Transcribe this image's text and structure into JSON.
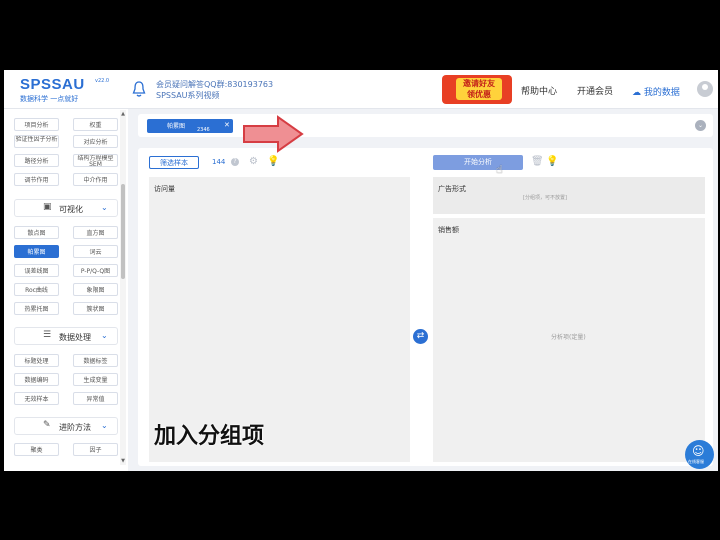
{
  "header": {
    "logo": {
      "title": "SPSSAU",
      "version": "v22.0",
      "slogan": "数据科学 一点就好"
    },
    "contact_line1": "会员疑问解答QQ群:830193763",
    "contact_line2": "SPSSAU系列视频",
    "promo": {
      "line1": "邀请好友",
      "line2": "领优惠"
    },
    "nav": [
      "帮助中心",
      "开通会员"
    ],
    "my_data": "我的数据"
  },
  "sidebar": {
    "top_buttons": [
      [
        "项目分析",
        "权重"
      ],
      [
        "验证性因子分析",
        "对应分析"
      ],
      [
        "路径分析",
        "结构方程模型SEM"
      ],
      [
        "调节作用",
        "中介作用"
      ]
    ],
    "visualization": {
      "title": "可视化",
      "buttons": [
        [
          "散点图",
          "直方图"
        ],
        [
          "帕累图",
          "词云"
        ],
        [
          "误差线图",
          "P-P/Q-Q图"
        ],
        [
          "Roc曲线",
          "象限图"
        ],
        [
          "热累托图",
          "簇状图"
        ]
      ],
      "active": "帕累图"
    },
    "data_processing": {
      "title": "数据处理",
      "buttons": [
        [
          "标题处理",
          "数据标签"
        ],
        [
          "数据编码",
          "生成变量"
        ],
        [
          "无效样本",
          "异常值"
        ]
      ]
    },
    "advanced": {
      "title": "进阶方法",
      "buttons": [
        [
          "聚类",
          "因子"
        ]
      ]
    }
  },
  "tabs": [
    {
      "label": "帕累图",
      "count": "2346"
    }
  ],
  "toolbar": {
    "filter_label": "筛选样本",
    "sample_count": "144",
    "start_label": "开始分析"
  },
  "fields": {
    "left_title": "访问量",
    "group_title": "广告形式",
    "group_hint": "[分组项，可不放置]",
    "value_title": "销售额",
    "value_hint": "分析项(定量)"
  },
  "subtitle": "加入分组项",
  "chat": {
    "label": "在线客服"
  },
  "colors": {
    "accent": "#2b6fd3",
    "promo_red": "#e83f24",
    "promo_yellow": "#ffd23b"
  }
}
